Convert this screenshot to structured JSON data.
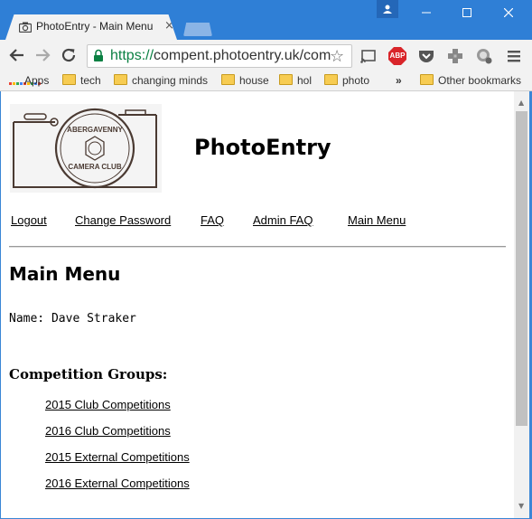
{
  "browser": {
    "tab_title": "PhotoEntry - Main Menu",
    "url_protocol": "https://",
    "url_rest": "compent.photoentry.uk/com",
    "extensions": [
      "cast-icon",
      "adblock-plus-icon",
      "pocket-icon",
      "puzzle-extension-icon",
      "globe-extension-icon",
      "menu-icon"
    ],
    "abp_label": "ABP"
  },
  "bookmarks": {
    "apps": "Apps",
    "items": [
      "tech",
      "changing minds",
      "house",
      "hol",
      "photo"
    ],
    "overflow": "»",
    "other": "Other bookmarks"
  },
  "page": {
    "logo_text_top": "ABERGAVENNY",
    "logo_text_bottom": "CAMERA CLUB",
    "site_title": "PhotoEntry",
    "nav": [
      "Logout",
      "Change Password",
      "FAQ",
      "Admin FAQ",
      "Main Menu"
    ],
    "heading": "Main Menu",
    "name_line": "Name: Dave Straker",
    "groups_heading": "Competition Groups:",
    "groups": [
      "2015 Club Competitions",
      "2016 Club Competitions",
      "2015 External Competitions",
      "2016 External Competitions"
    ]
  },
  "colors": {
    "titlebar": "#2f7fd6",
    "url_protocol": "#0b8043",
    "abp_red": "#d9252a"
  }
}
